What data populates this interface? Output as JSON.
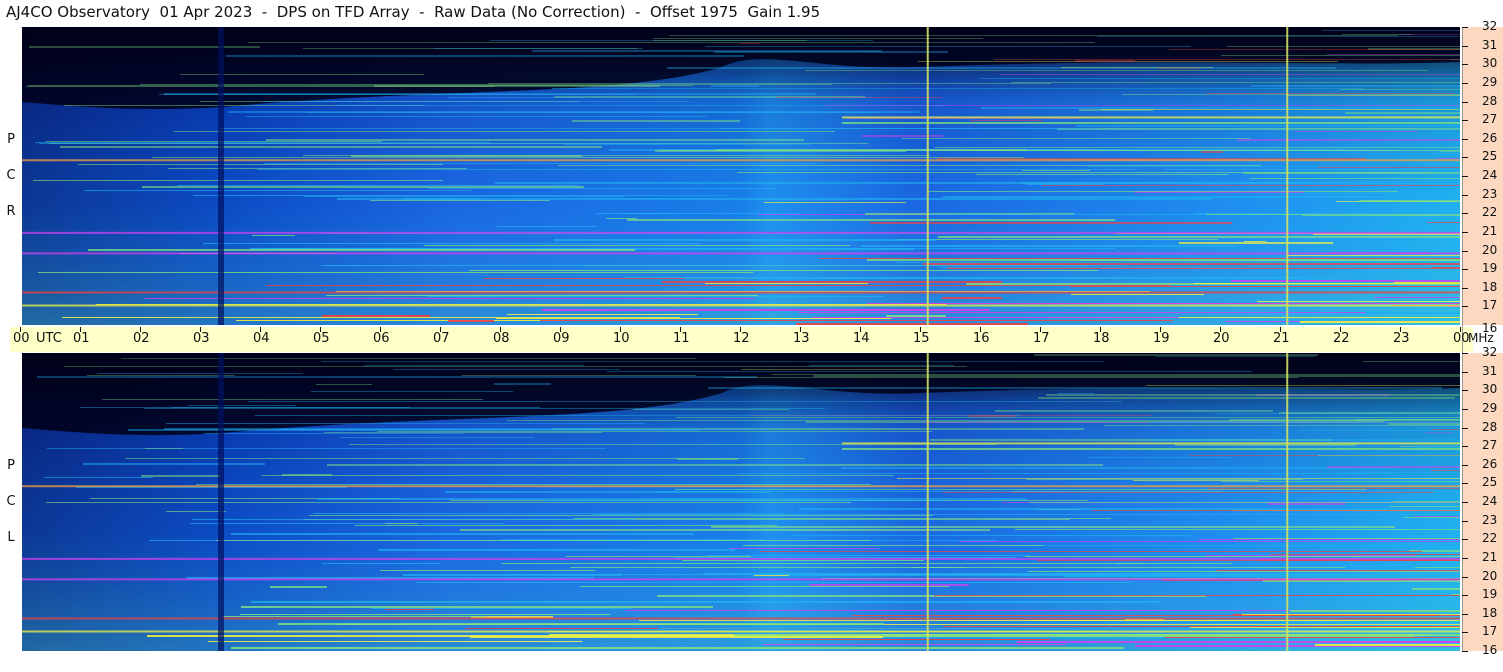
{
  "title": "AJ4CO Observatory  01 Apr 2023  -  DPS on TFD Array  -  Raw Data (No Correction)  -  Offset 1975  Gain 1.95",
  "panels": [
    {
      "id": "rcp",
      "side_letters": [
        "P",
        "C",
        "R"
      ]
    },
    {
      "id": "lcp",
      "side_letters": [
        "P",
        "C",
        "L"
      ]
    }
  ],
  "colors": {
    "background": "#000010",
    "dark_blue": "#0a2a8a",
    "blue": "#1a5fe0",
    "cyan": "#20b0f0",
    "green": "#7fe080",
    "yellow": "#f0f040",
    "red": "#f04040",
    "magenta": "#d040f0",
    "utc_bar": "#ffffc8",
    "side_strip": "#fcd8c0"
  },
  "chart_data": {
    "type": "heatmap",
    "title": "AJ4CO Observatory  01 Apr 2023  -  DPS on TFD Array  -  Raw Data (No Correction)  -  Offset 1975  Gain 1.95",
    "xlabel": "UTC",
    "ylabel": "MHz",
    "x_ticks": [
      "00",
      "01",
      "02",
      "03",
      "04",
      "05",
      "06",
      "07",
      "08",
      "09",
      "10",
      "11",
      "12",
      "13",
      "14",
      "15",
      "16",
      "17",
      "18",
      "19",
      "20",
      "21",
      "22",
      "23",
      "00"
    ],
    "y_ticks": [
      16,
      17,
      18,
      19,
      20,
      21,
      22,
      23,
      24,
      25,
      26,
      27,
      28,
      29,
      30,
      31,
      32
    ],
    "xlim": [
      0,
      24
    ],
    "ylim": [
      16,
      32
    ],
    "series": [
      {
        "name": "RCP",
        "description_letters": "R C P"
      },
      {
        "name": "LCP",
        "description_letters": "L C P"
      }
    ],
    "vertical_lines_utc": [
      15.1,
      21.1
    ]
  },
  "labels": {
    "utc": "UTC",
    "mhz": "MHz"
  }
}
